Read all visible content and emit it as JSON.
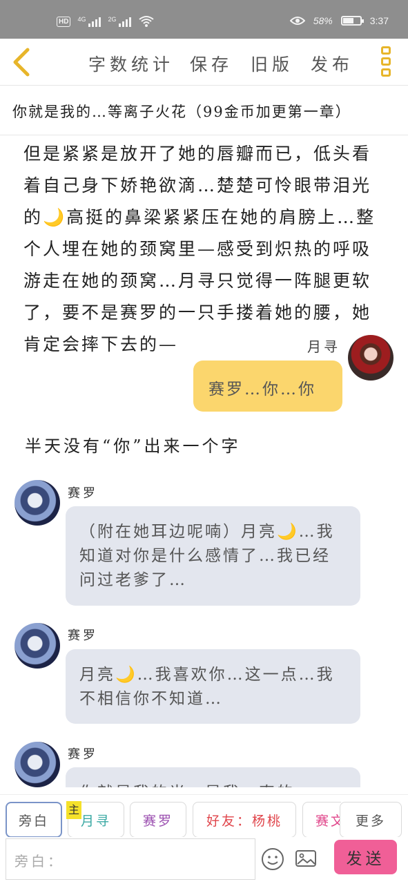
{
  "status_bar": {
    "hd_label": "HD",
    "signal1_label": "4G",
    "signal2_label": "2G",
    "battery_percent_text": "58%",
    "battery_level": 0.58,
    "time": "3:37"
  },
  "toolbar": {
    "word_count_label": "字数统计",
    "save_label": "保存",
    "old_version_label": "旧版",
    "publish_label": "发布",
    "accent_color": "#e7b52a"
  },
  "chapter_title": "你就是我的…等离子火花（99金币加更第一章）",
  "messages": {
    "narration1": "但是紧紧是放开了她的唇瓣而已，低头看着自己身下娇艳欲滴…楚楚可怜眼带泪光的🌙高挺的鼻梁紧紧压在她的肩膀上…整个人埋在她的颈窝里—感受到炽热的呼吸游走在她的颈窝…月寻只觉得一阵腿更软了，要不是赛罗的一只手搂着她的腰，她肯定会摔下去的—",
    "right_name": "月寻",
    "right_text": "赛罗…你…你",
    "narration2": "半天没有“你”出来一个字",
    "left1_name": "赛罗",
    "left1_text": "（附在她耳边呢喃）月亮🌙…我知道对你是什么感情了…我已经问过老爹了…",
    "left2_name": "赛罗",
    "left2_text": "月亮🌙…我喜欢你…这一点…我不相信你不知道…",
    "left3_name": "赛罗",
    "left3_text": "你就是我的光…是我一直的"
  },
  "characters": {
    "narrator": "旁白",
    "main_badge": "主",
    "yuexun": "月寻",
    "sailuo": "赛罗",
    "friend": "好友：杨桃",
    "partial": "赛文",
    "more": "更多"
  },
  "input": {
    "placeholder": "旁白：",
    "send_label": "发送"
  },
  "colors": {
    "right_bubble": "#fbd66d",
    "left_bubble": "#e3e6ee",
    "send_button": "#f05f97",
    "yuexun_chip": "#3aa9a3",
    "sailuo_chip": "#9b4fb0",
    "friend_chip": "#e0454b"
  }
}
